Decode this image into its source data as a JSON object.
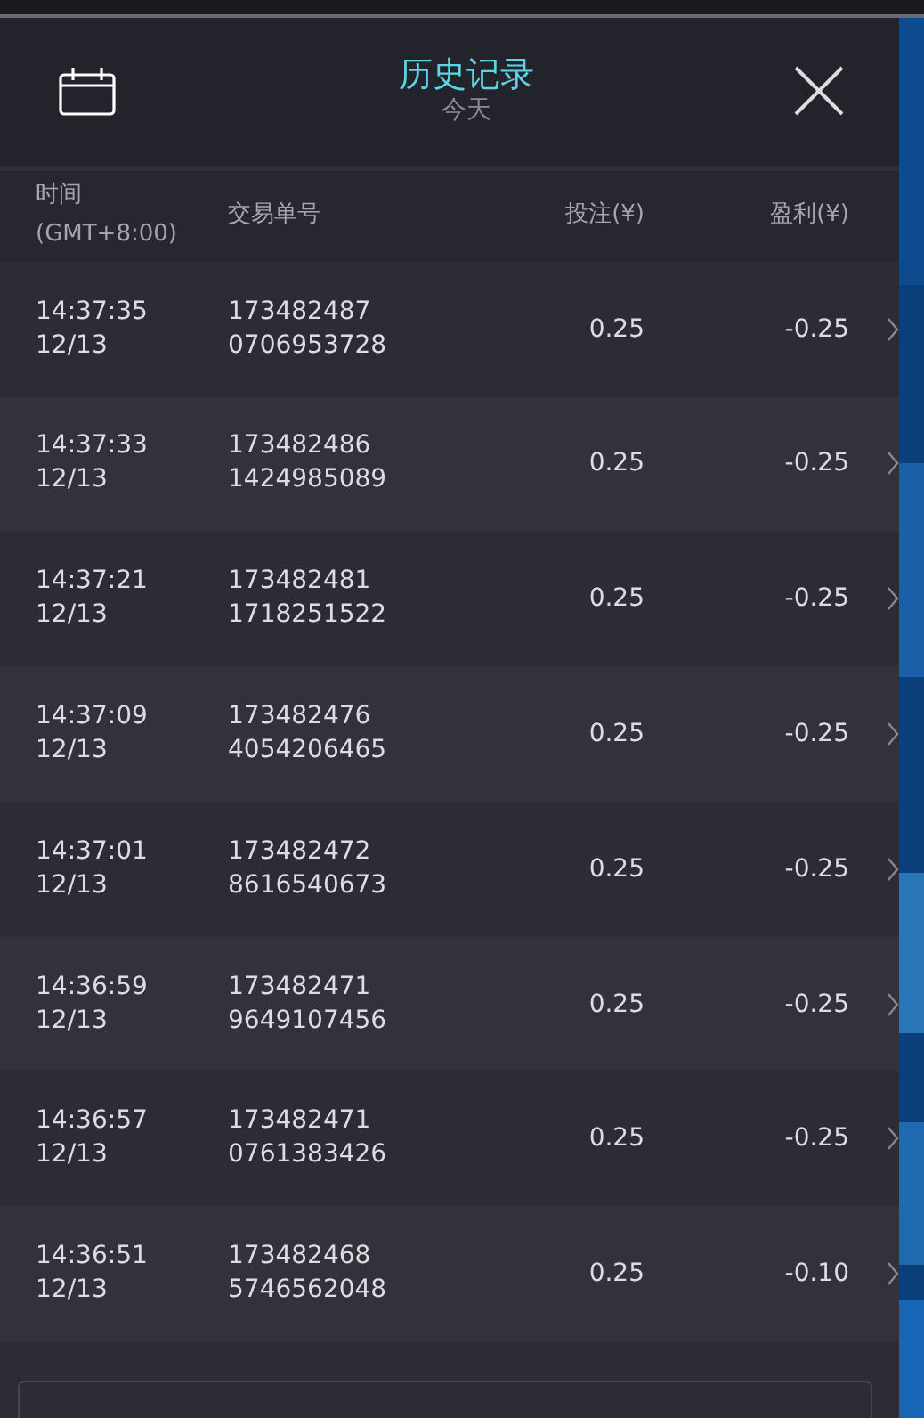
{
  "header": {
    "title": "历史记录",
    "subtitle": "今天"
  },
  "columns": [
    {
      "label": "时间",
      "sublabel": "(GMT+8:00)"
    },
    {
      "label": "交易单号"
    },
    {
      "label": "投注(¥)"
    },
    {
      "label": "盈利(¥)"
    }
  ],
  "rows": [
    {
      "time": "14:37:35",
      "date": "12/13",
      "id_line1": "173482487",
      "id_line2": "0706953728",
      "bet": "0.25",
      "profit": "-0.25"
    },
    {
      "time": "14:37:33",
      "date": "12/13",
      "id_line1": "173482486",
      "id_line2": "1424985089",
      "bet": "0.25",
      "profit": "-0.25"
    },
    {
      "time": "14:37:21",
      "date": "12/13",
      "id_line1": "173482481",
      "id_line2": "1718251522",
      "bet": "0.25",
      "profit": "-0.25"
    },
    {
      "time": "14:37:09",
      "date": "12/13",
      "id_line1": "173482476",
      "id_line2": "4054206465",
      "bet": "0.25",
      "profit": "-0.25"
    },
    {
      "time": "14:37:01",
      "date": "12/13",
      "id_line1": "173482472",
      "id_line2": "8616540673",
      "bet": "0.25",
      "profit": "-0.25"
    },
    {
      "time": "14:36:59",
      "date": "12/13",
      "id_line1": "173482471",
      "id_line2": "9649107456",
      "bet": "0.25",
      "profit": "-0.25"
    },
    {
      "time": "14:36:57",
      "date": "12/13",
      "id_line1": "173482471",
      "id_line2": "0761383426",
      "bet": "0.25",
      "profit": "-0.25"
    },
    {
      "time": "14:36:51",
      "date": "12/13",
      "id_line1": "173482468",
      "id_line2": "5746562048",
      "bet": "0.25",
      "profit": "-0.10"
    }
  ]
}
